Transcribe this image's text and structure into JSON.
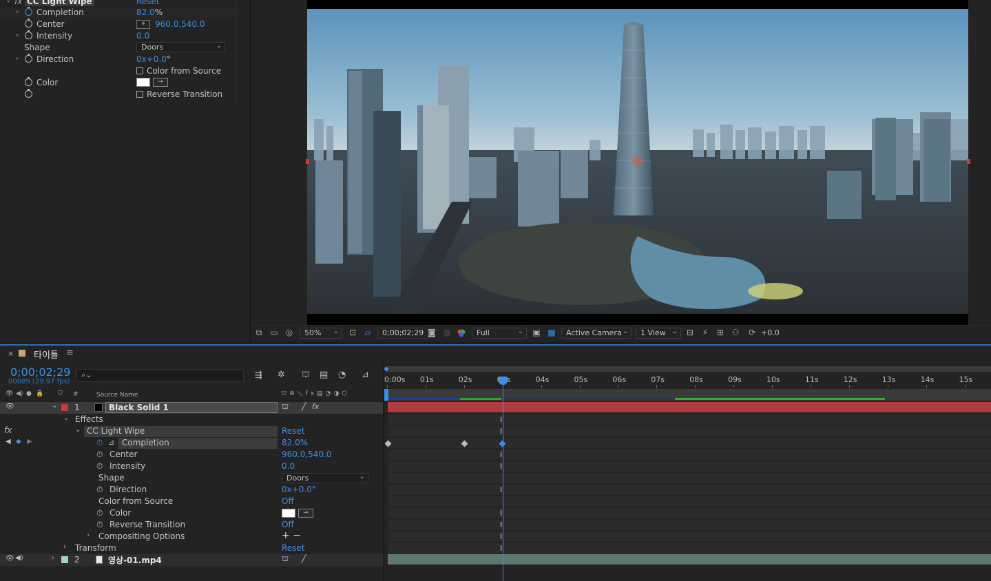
{
  "effect_controls": {
    "effect_name": "CC Light Wipe",
    "reset_label": "Reset",
    "props": [
      {
        "name": "Completion",
        "value": "82.0",
        "unit": "%"
      },
      {
        "name": "Center",
        "value": "960.0,540.0"
      },
      {
        "name": "Intensity",
        "value": "0.0"
      },
      {
        "name": "Shape",
        "value": "Doors"
      },
      {
        "name": "Direction",
        "value": "0x+0.0",
        "unit": "°"
      },
      {
        "name": "Color from Source"
      },
      {
        "name": "Color"
      },
      {
        "name": "Reverse Transition"
      }
    ]
  },
  "viewer_bar": {
    "zoom": "50%",
    "timecode": "0;00;02;29",
    "resolution": "Full",
    "camera": "Active Camera",
    "views": "1 View",
    "exposure": "+0.0"
  },
  "timeline": {
    "tab_title": "타이틀",
    "current_time": "0;00;02;29",
    "frame_info": "00089 (29.97 fps)",
    "search_placeholder": "",
    "col_num": "#",
    "col_source_name": "Source Name",
    "ruler": [
      "0:00s",
      "01s",
      "02s",
      "03s",
      "04s",
      "05s",
      "06s",
      "07s",
      "08s",
      "09s",
      "10s",
      "11s",
      "12s",
      "13s",
      "14s",
      "15s"
    ],
    "layer1": {
      "index": "1",
      "name": "Black Solid 1",
      "color": "#c83b3b"
    },
    "effects_label": "Effects",
    "effect_name": "CC Light Wipe",
    "reset": "Reset",
    "props": [
      {
        "name": "Completion",
        "value": "82.0%"
      },
      {
        "name": "Center",
        "value": "960.0,540.0"
      },
      {
        "name": "Intensity",
        "value": "0.0"
      },
      {
        "name": "Shape",
        "value": "Doors"
      },
      {
        "name": "Direction",
        "value": "0x+0.0°"
      },
      {
        "name": "Color from Source",
        "value": "Off"
      },
      {
        "name": "Color",
        "value": ""
      },
      {
        "name": "Reverse Transition",
        "value": "Off"
      },
      {
        "name": "Compositing Options",
        "value": "+ −"
      }
    ],
    "transform_label": "Transform",
    "transform_reset": "Reset",
    "layer2": {
      "index": "2",
      "name": "영상-01.mp4",
      "color": "#9fd1cf"
    }
  },
  "colors": {
    "accent": "#3b8fe8",
    "layer_bar": "#b13c3f",
    "layer2_bar": "#5e7772",
    "playhead": "#3b8fe8"
  }
}
